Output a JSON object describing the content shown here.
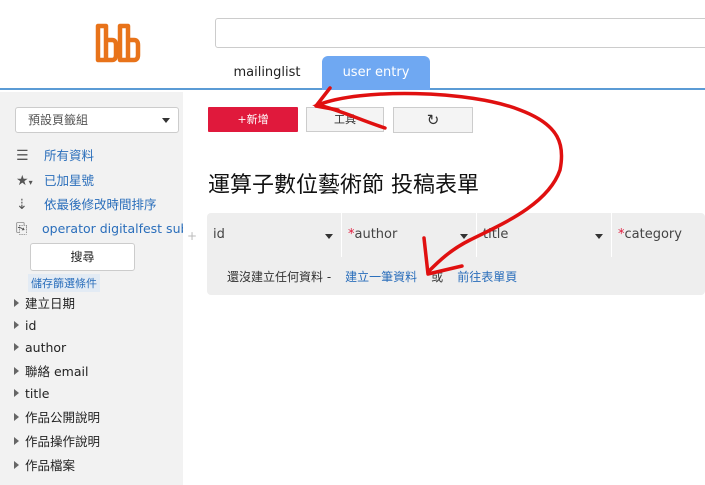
{
  "header": {
    "logo": "logo-icon",
    "search_value": "",
    "tabs": [
      {
        "label": "mailinglist",
        "active": false
      },
      {
        "label": "user entry",
        "active": true
      }
    ]
  },
  "sidebar": {
    "group_select": "預設頁籤組",
    "links": [
      {
        "icon": "list-icon",
        "label": "所有資料"
      },
      {
        "icon": "star-icon",
        "label": "已加星號"
      },
      {
        "icon": "sort-icon",
        "label": "依最後修改時間排序"
      },
      {
        "icon": "export-icon",
        "label": "operator digitalfest sub"
      }
    ],
    "search_button": "搜尋",
    "save_filter": "儲存篩選條件",
    "fields": [
      "建立日期",
      "id",
      "author",
      "聯絡 email",
      "title",
      "作品公開說明",
      "作品操作說明",
      "作品檔案"
    ]
  },
  "toolbar": {
    "new_label": "+新增",
    "tools_label": "工具",
    "refresh_icon": "refresh-icon"
  },
  "main": {
    "title": "運算子數位藝術節 投稿表單",
    "columns": [
      {
        "label": "id",
        "required": false
      },
      {
        "label": "author",
        "required": true
      },
      {
        "label": "title",
        "required": false
      },
      {
        "label": "category",
        "required": true
      }
    ],
    "empty_text": "還沒建立任何資料 -",
    "create_link": "建立一筆資料",
    "or_text": "或",
    "form_link": "前往表單頁"
  },
  "colors": {
    "accent": "#6fa8f2",
    "new_button": "#e0193c",
    "link": "#2a6ebb",
    "annotation": "#e01010",
    "logo": "#e8731a"
  }
}
